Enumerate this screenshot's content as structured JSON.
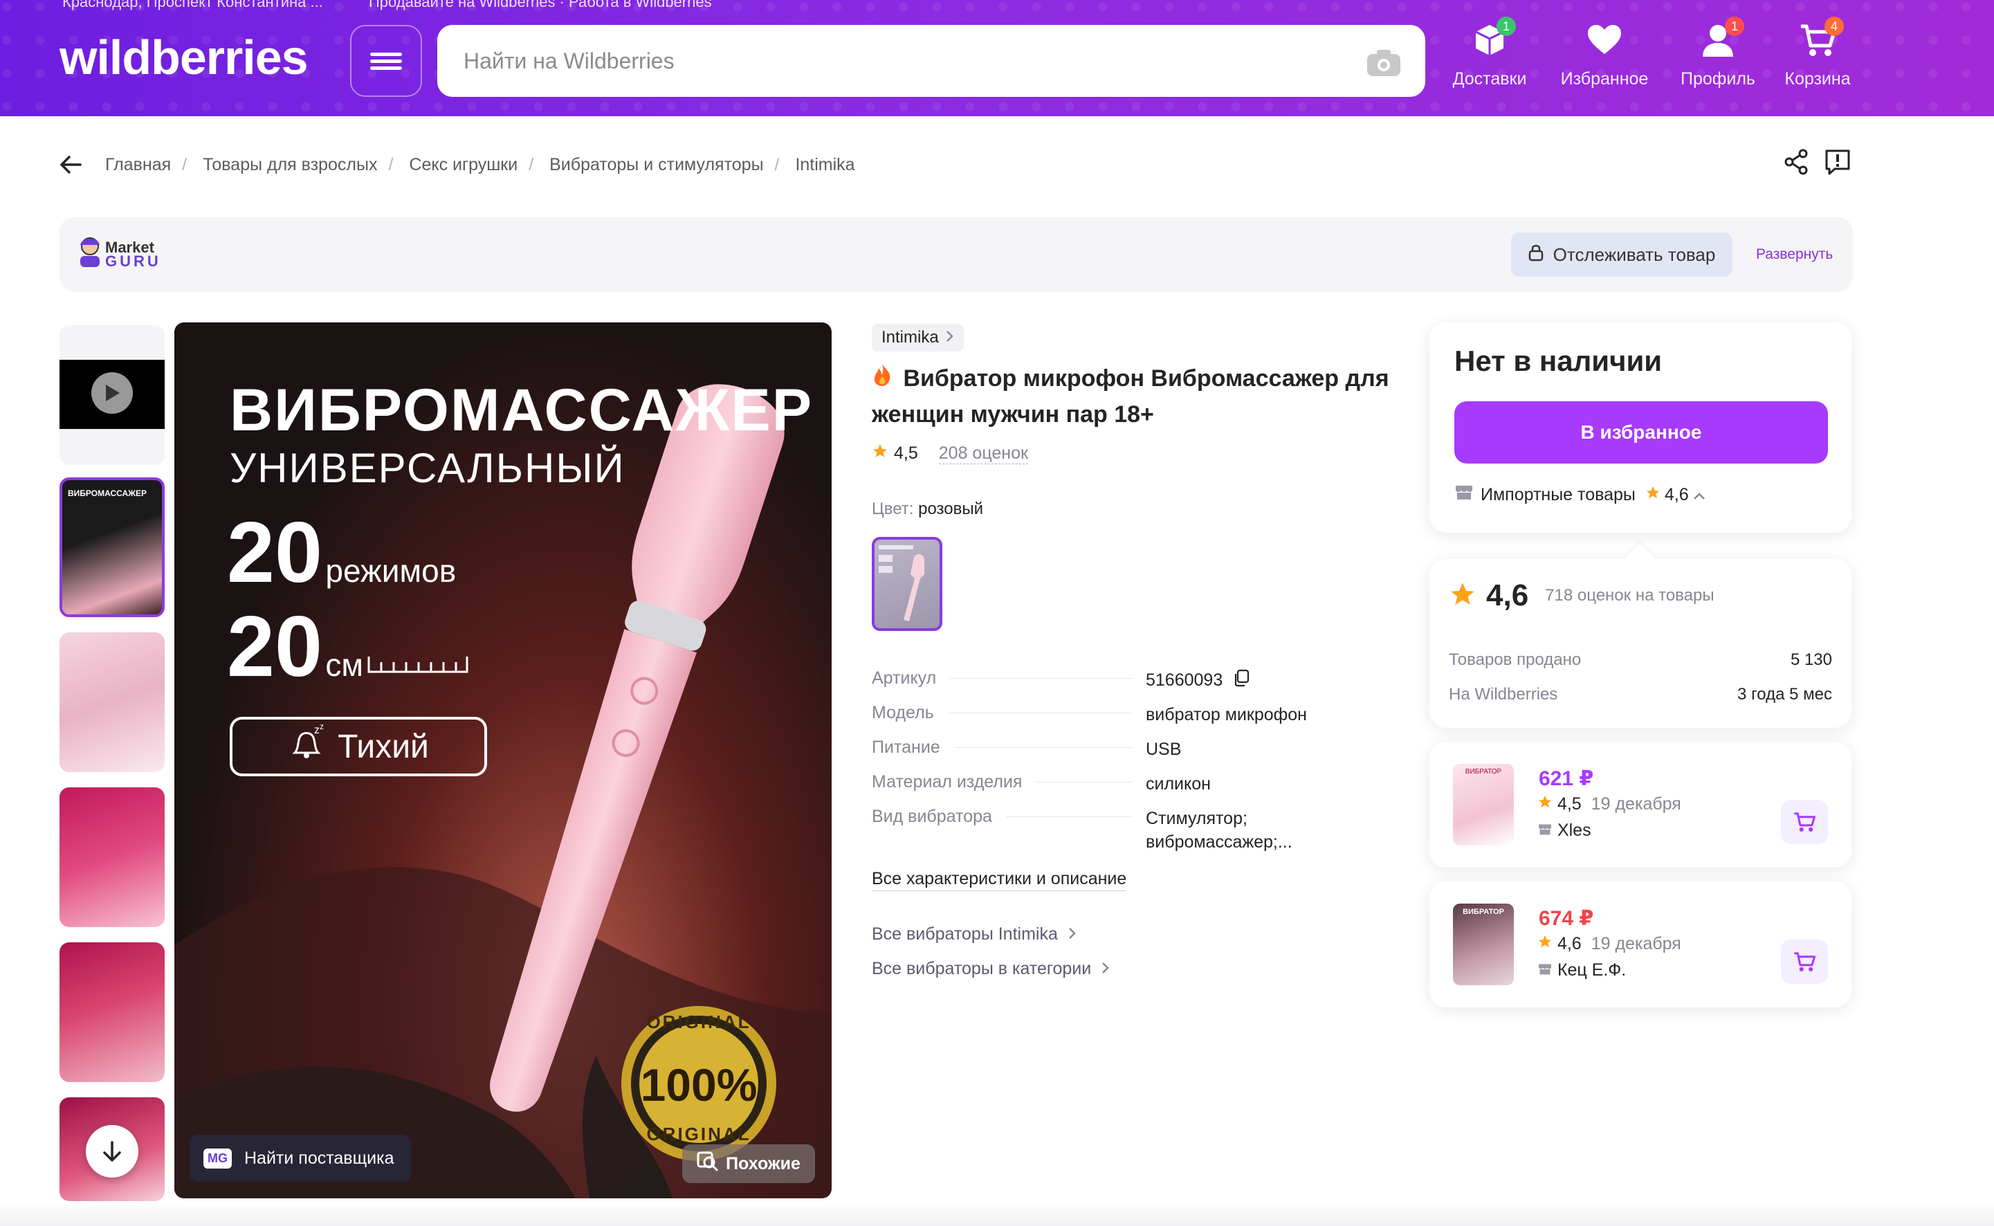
{
  "header": {
    "location": "Краснодар, Проспект Константина ...",
    "top_links": "Продавайте на Wildberries · Работа в Wildberries",
    "logo": "wildberries",
    "search_placeholder": "Найти на Wildberries",
    "nav": [
      {
        "label": "Доставки",
        "badge": "1",
        "icon": "delivery-box-icon",
        "badge_color": "#3ac46a"
      },
      {
        "label": "Избранное",
        "badge": "",
        "icon": "heart-icon",
        "badge_color": ""
      },
      {
        "label": "Профиль",
        "badge": "1",
        "icon": "profile-icon",
        "badge_color": "#ff4d4d"
      },
      {
        "label": "Корзина",
        "badge": "4",
        "icon": "cart-icon",
        "badge_color": "#ff6b35"
      }
    ]
  },
  "breadcrumbs": [
    "Главная",
    "Товары для взрослых",
    "Секс игрушки",
    "Вибраторы и стимуляторы",
    "Intimika"
  ],
  "market_guru": {
    "logo_line1": "Market",
    "logo_line2": "GURU",
    "track_label": "Отслеживать товар",
    "expand_label": "Развернуть"
  },
  "gallery": {
    "image_headline": "ВИБРОМАССАЖЕР",
    "image_sub": "УНИВЕРСАЛЬНЫЙ",
    "feature1_num": "20",
    "feature1_unit": "режимов",
    "feature2_num": "20",
    "feature2_unit": "см",
    "quiet_label": "Тихий",
    "seal_text": "100%",
    "seal_ring": "ORIGINAL",
    "find_supplier": "Найти поставщика",
    "find_supplier_badge": "MG",
    "similar": "Похожие"
  },
  "product": {
    "brand": "Intimika",
    "title": "Вибратор микрофон Вибромассажер для женщин мужчин пар 18+",
    "rating": "4,5",
    "reviews": "208 оценок",
    "color_label": "Цвет:",
    "color_value": "розовый",
    "specs": [
      {
        "k": "Артикул",
        "v": "51660093"
      },
      {
        "k": "Модель",
        "v": "вибратор микрофон"
      },
      {
        "k": "Питание",
        "v": "USB"
      },
      {
        "k": "Материал изделия",
        "v": "силикон"
      },
      {
        "k": "Вид вибратора",
        "v": "Стимулятор; вибромассажер;..."
      }
    ],
    "all_chars": "Все характеристики и описание",
    "link_brand": "Все вибраторы Intimika",
    "link_category": "Все вибраторы в категории"
  },
  "stock_card": {
    "title": "Нет в наличии",
    "fav_button": "В избранное",
    "seller_name": "Импортные товары",
    "seller_rating": "4,6"
  },
  "seller_card": {
    "rating": "4,6",
    "reviews": "718 оценок на товары",
    "sold_label": "Товаров продано",
    "sold_value": "5 130",
    "on_wb_label": "На Wildberries",
    "on_wb_value": "3 года 5 мес"
  },
  "offers": [
    {
      "price": "621 ₽",
      "price_color": "#a73afd",
      "rating": "4,5",
      "date": "19 декабря",
      "seller": "Xles",
      "img_label": "ВИБРАТОР"
    },
    {
      "price": "674 ₽",
      "price_color": "#f0454a",
      "rating": "4,6",
      "date": "19 декабря",
      "seller": "Кец Е.Ф.",
      "img_label": "ВИБРАТОР"
    }
  ]
}
